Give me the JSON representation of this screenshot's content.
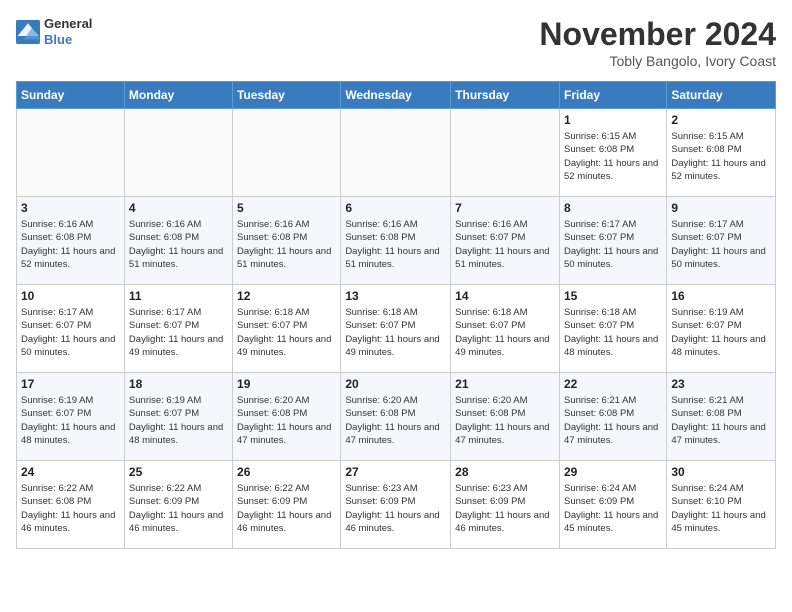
{
  "header": {
    "logo_line1": "General",
    "logo_line2": "Blue",
    "month_title": "November 2024",
    "location": "Tobly Bangolo, Ivory Coast"
  },
  "weekdays": [
    "Sunday",
    "Monday",
    "Tuesday",
    "Wednesday",
    "Thursday",
    "Friday",
    "Saturday"
  ],
  "weeks": [
    [
      {
        "day": "",
        "sunrise": "",
        "sunset": "",
        "daylight": "",
        "empty": true
      },
      {
        "day": "",
        "sunrise": "",
        "sunset": "",
        "daylight": "",
        "empty": true
      },
      {
        "day": "",
        "sunrise": "",
        "sunset": "",
        "daylight": "",
        "empty": true
      },
      {
        "day": "",
        "sunrise": "",
        "sunset": "",
        "daylight": "",
        "empty": true
      },
      {
        "day": "",
        "sunrise": "",
        "sunset": "",
        "daylight": "",
        "empty": true
      },
      {
        "day": "1",
        "sunrise": "6:15 AM",
        "sunset": "6:08 PM",
        "daylight": "11 hours and 52 minutes.",
        "empty": false
      },
      {
        "day": "2",
        "sunrise": "6:15 AM",
        "sunset": "6:08 PM",
        "daylight": "11 hours and 52 minutes.",
        "empty": false
      }
    ],
    [
      {
        "day": "3",
        "sunrise": "6:16 AM",
        "sunset": "6:08 PM",
        "daylight": "11 hours and 52 minutes.",
        "empty": false
      },
      {
        "day": "4",
        "sunrise": "6:16 AM",
        "sunset": "6:08 PM",
        "daylight": "11 hours and 51 minutes.",
        "empty": false
      },
      {
        "day": "5",
        "sunrise": "6:16 AM",
        "sunset": "6:08 PM",
        "daylight": "11 hours and 51 minutes.",
        "empty": false
      },
      {
        "day": "6",
        "sunrise": "6:16 AM",
        "sunset": "6:08 PM",
        "daylight": "11 hours and 51 minutes.",
        "empty": false
      },
      {
        "day": "7",
        "sunrise": "6:16 AM",
        "sunset": "6:07 PM",
        "daylight": "11 hours and 51 minutes.",
        "empty": false
      },
      {
        "day": "8",
        "sunrise": "6:17 AM",
        "sunset": "6:07 PM",
        "daylight": "11 hours and 50 minutes.",
        "empty": false
      },
      {
        "day": "9",
        "sunrise": "6:17 AM",
        "sunset": "6:07 PM",
        "daylight": "11 hours and 50 minutes.",
        "empty": false
      }
    ],
    [
      {
        "day": "10",
        "sunrise": "6:17 AM",
        "sunset": "6:07 PM",
        "daylight": "11 hours and 50 minutes.",
        "empty": false
      },
      {
        "day": "11",
        "sunrise": "6:17 AM",
        "sunset": "6:07 PM",
        "daylight": "11 hours and 49 minutes.",
        "empty": false
      },
      {
        "day": "12",
        "sunrise": "6:18 AM",
        "sunset": "6:07 PM",
        "daylight": "11 hours and 49 minutes.",
        "empty": false
      },
      {
        "day": "13",
        "sunrise": "6:18 AM",
        "sunset": "6:07 PM",
        "daylight": "11 hours and 49 minutes.",
        "empty": false
      },
      {
        "day": "14",
        "sunrise": "6:18 AM",
        "sunset": "6:07 PM",
        "daylight": "11 hours and 49 minutes.",
        "empty": false
      },
      {
        "day": "15",
        "sunrise": "6:18 AM",
        "sunset": "6:07 PM",
        "daylight": "11 hours and 48 minutes.",
        "empty": false
      },
      {
        "day": "16",
        "sunrise": "6:19 AM",
        "sunset": "6:07 PM",
        "daylight": "11 hours and 48 minutes.",
        "empty": false
      }
    ],
    [
      {
        "day": "17",
        "sunrise": "6:19 AM",
        "sunset": "6:07 PM",
        "daylight": "11 hours and 48 minutes.",
        "empty": false
      },
      {
        "day": "18",
        "sunrise": "6:19 AM",
        "sunset": "6:07 PM",
        "daylight": "11 hours and 48 minutes.",
        "empty": false
      },
      {
        "day": "19",
        "sunrise": "6:20 AM",
        "sunset": "6:08 PM",
        "daylight": "11 hours and 47 minutes.",
        "empty": false
      },
      {
        "day": "20",
        "sunrise": "6:20 AM",
        "sunset": "6:08 PM",
        "daylight": "11 hours and 47 minutes.",
        "empty": false
      },
      {
        "day": "21",
        "sunrise": "6:20 AM",
        "sunset": "6:08 PM",
        "daylight": "11 hours and 47 minutes.",
        "empty": false
      },
      {
        "day": "22",
        "sunrise": "6:21 AM",
        "sunset": "6:08 PM",
        "daylight": "11 hours and 47 minutes.",
        "empty": false
      },
      {
        "day": "23",
        "sunrise": "6:21 AM",
        "sunset": "6:08 PM",
        "daylight": "11 hours and 47 minutes.",
        "empty": false
      }
    ],
    [
      {
        "day": "24",
        "sunrise": "6:22 AM",
        "sunset": "6:08 PM",
        "daylight": "11 hours and 46 minutes.",
        "empty": false
      },
      {
        "day": "25",
        "sunrise": "6:22 AM",
        "sunset": "6:09 PM",
        "daylight": "11 hours and 46 minutes.",
        "empty": false
      },
      {
        "day": "26",
        "sunrise": "6:22 AM",
        "sunset": "6:09 PM",
        "daylight": "11 hours and 46 minutes.",
        "empty": false
      },
      {
        "day": "27",
        "sunrise": "6:23 AM",
        "sunset": "6:09 PM",
        "daylight": "11 hours and 46 minutes.",
        "empty": false
      },
      {
        "day": "28",
        "sunrise": "6:23 AM",
        "sunset": "6:09 PM",
        "daylight": "11 hours and 46 minutes.",
        "empty": false
      },
      {
        "day": "29",
        "sunrise": "6:24 AM",
        "sunset": "6:09 PM",
        "daylight": "11 hours and 45 minutes.",
        "empty": false
      },
      {
        "day": "30",
        "sunrise": "6:24 AM",
        "sunset": "6:10 PM",
        "daylight": "11 hours and 45 minutes.",
        "empty": false
      }
    ]
  ]
}
